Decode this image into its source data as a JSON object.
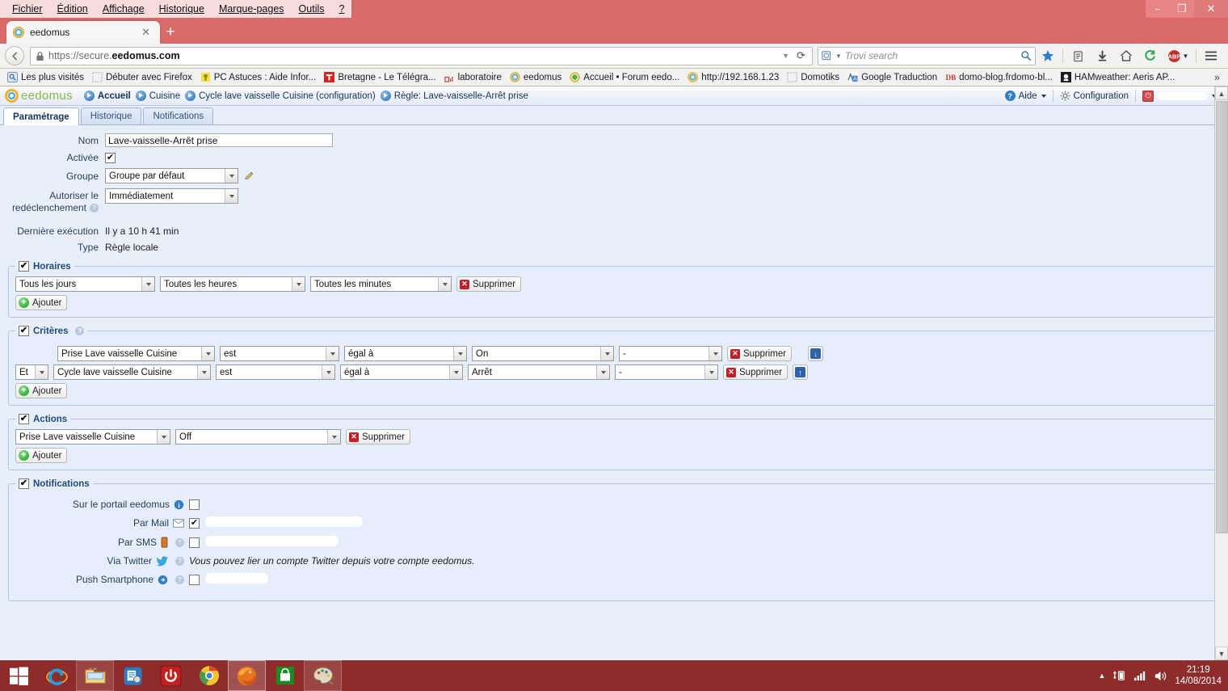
{
  "browser": {
    "menus": [
      "Fichier",
      "Édition",
      "Affichage",
      "Historique",
      "Marque-pages",
      "Outils",
      "?"
    ],
    "window_controls": {
      "minimize": "−",
      "maximize": "❐",
      "close": "✕"
    },
    "tab": {
      "title": "eedomus",
      "close": "✕",
      "favicon": "eedomus-ring-icon"
    },
    "new_tab": "+",
    "url": {
      "scheme": "https://secure.",
      "domain": "eedomus.com",
      "full": "https://secure.eedomus.com"
    },
    "search": {
      "placeholder": "Trovi search",
      "engine_icon": "magnifier-icon"
    },
    "toolbar_icons": [
      "bookmark-star-icon",
      "reading-list-icon",
      "downloads-icon",
      "home-icon",
      "sync-icon",
      "adblock-icon",
      "hamburger-menu-icon"
    ],
    "bookmarks": [
      {
        "label": "Les plus visités",
        "icon": "most-visited-icon"
      },
      {
        "label": "Débuter avec Firefox",
        "icon": "blank-favicon"
      },
      {
        "label": "PC Astuces : Aide Infor...",
        "icon": "bulb-icon"
      },
      {
        "label": "Bretagne - Le Télégra...",
        "icon": "telegramme-t-icon"
      },
      {
        "label": "laboratoire",
        "icon": "lab-icon"
      },
      {
        "label": "eedomus",
        "icon": "eedomus-ring-icon"
      },
      {
        "label": "Accueil • Forum eedo...",
        "icon": "forum-icon"
      },
      {
        "label": "http://192.168.1.23",
        "icon": "eedomus-ring-icon"
      },
      {
        "label": "Domotiks",
        "icon": "blank-favicon"
      },
      {
        "label": "Google Traduction",
        "icon": "translate-icon"
      },
      {
        "label": "domo-blog.frdomo-bl...",
        "icon": "db-icon"
      },
      {
        "label": "HAMweather: Aeris AP...",
        "icon": "hamweather-icon"
      }
    ],
    "bookmarks_overflow": "»"
  },
  "app": {
    "logo_text": "eedomus",
    "breadcrumb": [
      "Accueil",
      "Cuisine",
      "Cycle lave vaisselle Cuisine (configuration)",
      "Règle: Lave-vaisselle-Arrêt prise"
    ],
    "header_right": {
      "help": "Aide",
      "config": "Configuration",
      "account": ""
    },
    "tabs": [
      {
        "label": "Paramétrage",
        "active": true
      },
      {
        "label": "Historique",
        "active": false
      },
      {
        "label": "Notifications",
        "active": false
      }
    ]
  },
  "form": {
    "nom": {
      "label": "Nom",
      "value": "Lave-vaisselle-Arrêt prise"
    },
    "activee": {
      "label": "Activée",
      "checked": true
    },
    "groupe": {
      "label": "Groupe",
      "value": "Groupe par défaut"
    },
    "redeclenchement": {
      "label_line1": "Autoriser le",
      "label_line2": "redéclenchement",
      "value": "Immédiatement"
    },
    "derniere_execution": {
      "label": "Dernière exécution",
      "value": "Il y a 10 h 41 min"
    },
    "type": {
      "label": "Type",
      "value": "Règle locale"
    }
  },
  "horaires": {
    "legend": "Horaires",
    "checked": true,
    "rows": [
      {
        "jour": "Tous les jours",
        "heure": "Toutes les heures",
        "minute": "Toutes les minutes",
        "delete": "Supprimer"
      }
    ],
    "add": "Ajouter"
  },
  "criteres": {
    "legend": "Critères",
    "checked": true,
    "rows": [
      {
        "op": null,
        "source": "Prise Lave vaisselle Cuisine",
        "verb": "est",
        "comp": "égal à",
        "value": "On",
        "extra": "-",
        "delete": "Supprimer",
        "move": "down"
      },
      {
        "op": "Et",
        "source": "Cycle lave vaisselle Cuisine",
        "verb": "est",
        "comp": "égal à",
        "value": "Arrêt",
        "extra": "-",
        "delete": "Supprimer",
        "move": "up"
      }
    ],
    "add": "Ajouter"
  },
  "actions": {
    "legend": "Actions",
    "checked": true,
    "rows": [
      {
        "target": "Prise Lave vaisselle Cuisine",
        "command": "Off",
        "delete": "Supprimer"
      }
    ],
    "add": "Ajouter"
  },
  "notifications": {
    "legend": "Notifications",
    "checked": true,
    "rows": [
      {
        "label": "Sur le portail eedomus",
        "icon": "info-icon",
        "checked": false,
        "value": "",
        "redacted": true,
        "note": ""
      },
      {
        "label": "Par Mail",
        "icon": "mail-icon",
        "checked": true,
        "value": "",
        "redacted": true,
        "note": ""
      },
      {
        "label": "Par SMS",
        "icon": "sms-icon",
        "checked": false,
        "value": "",
        "redacted": true,
        "note": ""
      },
      {
        "label": "Via Twitter",
        "icon": "twitter-icon",
        "checked": null,
        "value": "",
        "redacted": false,
        "note": "Vous pouvez lier un compte Twitter depuis votre compte eedomus."
      },
      {
        "label": "Push Smartphone",
        "icon": "push-icon",
        "checked": false,
        "value": "",
        "redacted": true,
        "note": ""
      }
    ]
  },
  "taskbar": {
    "items": [
      {
        "name": "start-button",
        "icon": "windows-logo"
      },
      {
        "name": "internet-explorer",
        "icon": "ie-icon"
      },
      {
        "name": "file-explorer",
        "icon": "folder-icon"
      },
      {
        "name": "settings-app",
        "icon": "list-gear-icon"
      },
      {
        "name": "power-app",
        "icon": "power-icon"
      },
      {
        "name": "google-chrome",
        "icon": "chrome-icon"
      },
      {
        "name": "mozilla-firefox",
        "icon": "firefox-icon"
      },
      {
        "name": "windows-store",
        "icon": "store-icon"
      },
      {
        "name": "paint-app",
        "icon": "paint-icon"
      }
    ],
    "tray": [
      "show-hidden-icons",
      "usb-battery-icon",
      "signal-icon",
      "volume-icon"
    ],
    "clock": {
      "time": "21:19",
      "date": "14/08/2014"
    }
  }
}
